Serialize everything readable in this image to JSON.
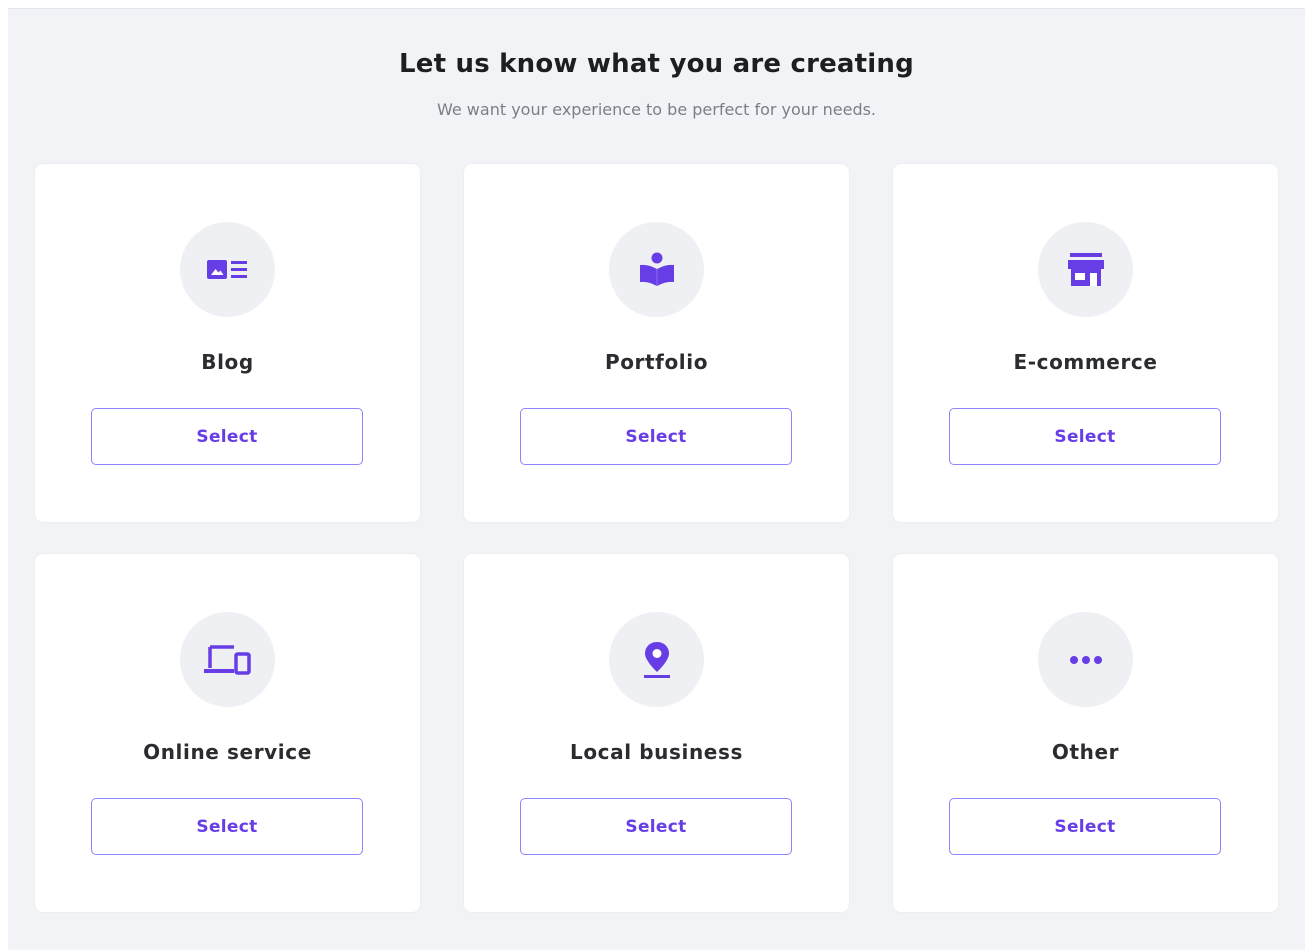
{
  "header": {
    "title": "Let us know what you are creating",
    "subtitle": "We want your experience to be perfect for your needs."
  },
  "colors": {
    "accent": "#673de6",
    "button_border": "#8c85ff",
    "page_background": "#f2f3f7",
    "icon_circle": "#eff0f4"
  },
  "options": [
    {
      "label": "Blog",
      "icon": "blog-post-icon",
      "button_label": "Select"
    },
    {
      "label": "Portfolio",
      "icon": "book-reader-icon",
      "button_label": "Select"
    },
    {
      "label": "E-commerce",
      "icon": "store-icon",
      "button_label": "Select"
    },
    {
      "label": "Online service",
      "icon": "devices-icon",
      "button_label": "Select"
    },
    {
      "label": "Local business",
      "icon": "location-pin-icon",
      "button_label": "Select"
    },
    {
      "label": "Other",
      "icon": "more-dots-icon",
      "button_label": "Select"
    }
  ]
}
